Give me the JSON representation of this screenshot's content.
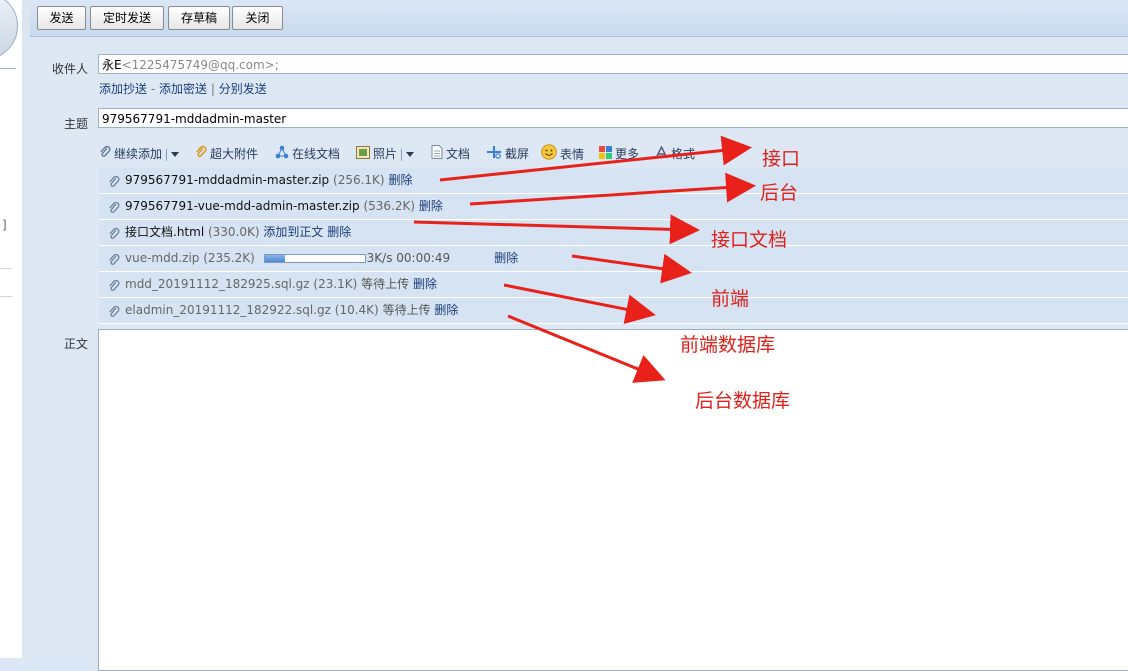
{
  "toolbar": {
    "send": "发送",
    "scheduled_send": "定时发送",
    "save_draft": "存草稿",
    "close": "关闭"
  },
  "sidebar": {
    "fragment": "]"
  },
  "recipient": {
    "label": "收件人",
    "name": "永E",
    "address": "<1225475749@qq.com>;"
  },
  "recipient_links": {
    "add_cc": "添加抄送",
    "sep1": "-",
    "add_bcc": "添加密送",
    "sep2": "|",
    "separate_send": "分别发送"
  },
  "subject": {
    "label": "主题",
    "value": "979567791-mddadmin-master"
  },
  "attach_toolbar": {
    "continue_add": "继续添加",
    "large_attachment": "超大附件",
    "online_doc": "在线文档",
    "photo": "照片",
    "document": "文档",
    "screenshot": "截屏",
    "emoji": "表情",
    "more": "更多",
    "format": "格式"
  },
  "attachments": [
    {
      "name": "979567791-mddadmin-master.zip",
      "size": "(256.1K)",
      "action1": "删除",
      "action2": "",
      "status": "",
      "pending": false
    },
    {
      "name": "979567791-vue-mdd-admin-master.zip",
      "size": "(536.2K)",
      "action1": "删除",
      "action2": "",
      "status": "",
      "pending": false
    },
    {
      "name": "接口文档.html",
      "size": "(330.0K)",
      "action1": "添加到正文",
      "action2": "删除",
      "status": "",
      "pending": false
    },
    {
      "name": "vue-mdd.zip",
      "size": "(235.2K)",
      "action1": "删除",
      "action2": "",
      "status": "3K/s 00:00:49",
      "pending": true,
      "progress": 0.2
    },
    {
      "name": "mdd_20191112_182925.sql.gz",
      "size": "(23.1K)",
      "action1": "删除",
      "action2": "",
      "status": "等待上传",
      "pending": true
    },
    {
      "name": "eladmin_20191112_182922.sql.gz",
      "size": "(10.4K)",
      "action1": "删除",
      "action2": "",
      "status": "等待上传",
      "pending": true
    }
  ],
  "body": {
    "label": "正文"
  },
  "annotations": {
    "a1": "接口",
    "a2": "后台",
    "a3": "接口文档",
    "a4": "前端",
    "a5": "前端数据库",
    "a6": "后台数据库",
    "color": "#e0201a"
  }
}
